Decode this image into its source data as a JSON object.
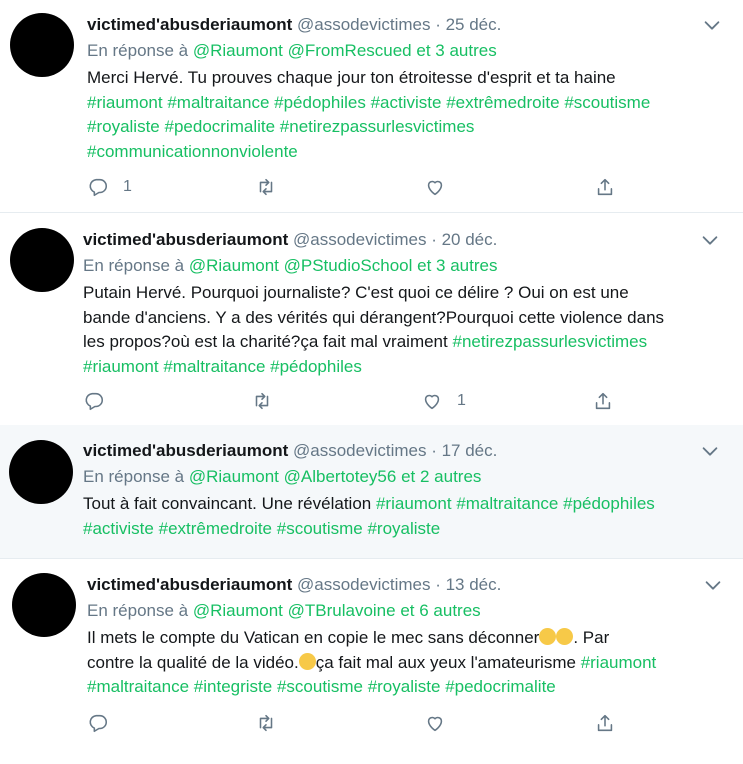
{
  "tweets": [
    {
      "name": "victimed'abusderiaumont",
      "handle": "@assodevictimes",
      "time": "· 25 déc.",
      "reply_prefix": "En réponse à",
      "reply_mentions": [
        "@Riaumont",
        "@FromRescued"
      ],
      "reply_others": "et 3 autres",
      "text": "Merci Hervé. Tu prouves chaque jour ton étroitesse d'esprit et ta haine",
      "hashtags": [
        "#riaumont",
        "#maltraitance",
        "#pédophiles",
        "#activiste",
        "#extrêmedroite",
        "#scoutisme",
        "#royaliste",
        "#pedocrimalite",
        "#netirezpassurlesvictimes",
        "#communicationnonviolente"
      ],
      "reply_count": "1",
      "retweet_count": "",
      "like_count": ""
    },
    {
      "name": "victimed'abusderiaumont",
      "handle": "@assodevictimes",
      "time": "· 20 déc.",
      "reply_prefix": "En réponse à",
      "reply_mentions": [
        "@Riaumont",
        "@PStudioSchool"
      ],
      "reply_others": "et 3 autres",
      "text_lines": [
        "Putain Hervé. Pourquoi journaliste? C'est quoi ce délire ? Oui on est une",
        "bande d'anciens. Y a des vérités qui dérangent?Pourquoi cette violence dans",
        "les propos?où est la charité?ça fait mal vraiment"
      ],
      "hashtags": [
        "#netirezpassurlesvictimes",
        "#riaumont",
        "#maltraitance",
        "#pédophiles"
      ],
      "reply_count": "",
      "retweet_count": "",
      "like_count": "1"
    },
    {
      "name": "victimed'abusderiaumont",
      "handle": "@assodevictimes",
      "time": "· 17 déc.",
      "reply_prefix": "En réponse à",
      "reply_mentions": [
        "@Riaumont",
        "@Albertotey56"
      ],
      "reply_others": "et 2 autres",
      "text": "Tout à fait convaincant. Une révélation",
      "hashtags": [
        "#riaumont",
        "#maltraitance",
        "#pédophiles",
        "#activiste",
        "#extrêmedroite",
        "#scoutisme",
        "#royaliste"
      ]
    },
    {
      "name": "victimed'abusderiaumont",
      "handle": "@assodevictimes",
      "time": "· 13 déc.",
      "reply_prefix": "En réponse à",
      "reply_mentions": [
        "@Riaumont",
        "@TBrulavoine"
      ],
      "reply_others": "et 6 autres",
      "text_a": "Il mets le compte du Vatican en copie le mec sans déconner",
      "text_b": ". Par",
      "text_c": "contre la qualité de la vidéo.",
      "text_d": "ça fait mal aux yeux l'amateurisme",
      "hashtags": [
        "#riaumont",
        "#maltraitance",
        "#integriste",
        "#scoutisme",
        "#royaliste",
        "#pedocrimalite"
      ],
      "reply_count": "",
      "retweet_count": "",
      "like_count": ""
    }
  ],
  "colors": {
    "hashtag": "#17bf63",
    "mention": "#1da1f2",
    "muted": "#657786",
    "highlight_bg": "#f5f8fa"
  },
  "icons": [
    "reply-icon",
    "retweet-icon",
    "like-icon",
    "share-icon",
    "chevron-down-icon",
    "rofl-emoji",
    "speechless-emoji"
  ]
}
